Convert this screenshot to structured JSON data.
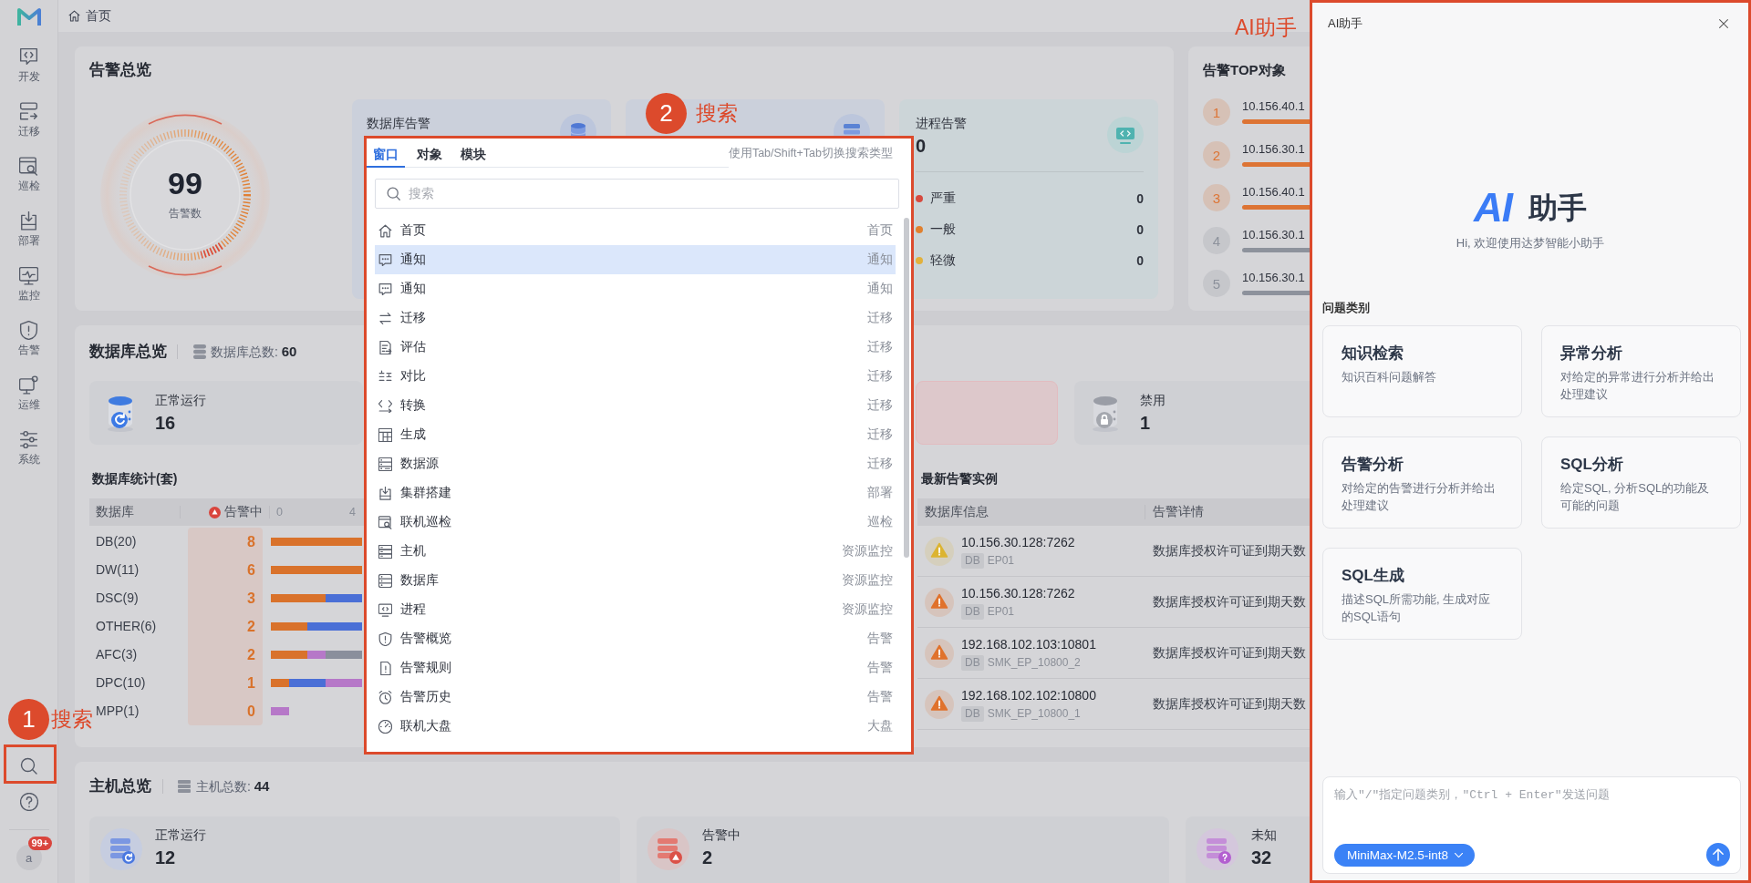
{
  "breadcrumb": {
    "label": "首页"
  },
  "sidebar": {
    "items": [
      {
        "label": "开发"
      },
      {
        "label": "迁移"
      },
      {
        "label": "巡检"
      },
      {
        "label": "部署"
      },
      {
        "label": "监控"
      },
      {
        "label": "告警"
      },
      {
        "label": "运维"
      },
      {
        "label": "系统"
      }
    ],
    "avatar": "a",
    "badge": "99+"
  },
  "alarm_overview": {
    "title": "告警总览",
    "total": "99",
    "total_label": "告警数",
    "cards": [
      {
        "kind": "database",
        "title": "数据库告警"
      },
      {
        "kind": "host"
      },
      {
        "kind": "process",
        "title": "进程告警",
        "value": "0",
        "levels": [
          {
            "label": "严重",
            "count": "0",
            "color": "#d64a3f"
          },
          {
            "label": "一般",
            "count": "0",
            "color": "#e0802f"
          },
          {
            "label": "轻微",
            "count": "0",
            "color": "#e2b13c"
          }
        ]
      }
    ]
  },
  "top_objects": {
    "title": "告警TOP对象",
    "items": [
      {
        "rank": "1",
        "name": "10.156.40.1",
        "color": "#dd7434"
      },
      {
        "rank": "2",
        "name": "10.156.30.1",
        "color": "#dd7434"
      },
      {
        "rank": "3",
        "name": "10.156.40.1",
        "color": "#dd7434"
      },
      {
        "rank": "4",
        "name": "10.156.30.1",
        "color": "#8d929c"
      },
      {
        "rank": "5",
        "name": "10.156.30.1",
        "color": "#8d929c"
      }
    ]
  },
  "database_overview": {
    "title": "数据库总览",
    "total": "数据库总数: **60**",
    "tiles": [
      {
        "kind": "normal",
        "label": "正常运行",
        "value": "16"
      },
      {
        "kind": "alarm"
      },
      {
        "kind": "disabled",
        "label": "禁用",
        "value": "1"
      }
    ],
    "stats": {
      "title": "数据库统计(套)",
      "columns": [
        "数据库",
        "告警中"
      ],
      "ticks": [
        "0",
        "4"
      ],
      "rows": [
        {
          "name": "DB(20)",
          "alarm": "8"
        },
        {
          "name": "DW(11)",
          "alarm": "6"
        },
        {
          "name": "DSC(9)",
          "alarm": "3"
        },
        {
          "name": "OTHER(6)",
          "alarm": "2"
        },
        {
          "name": "AFC(3)",
          "alarm": "2"
        },
        {
          "name": "DPC(10)",
          "alarm": "1"
        },
        {
          "name": "MPP(1)",
          "alarm": "0"
        }
      ]
    },
    "latest_alarms": {
      "title": "最新告警实例",
      "columns": [
        "数据库信息",
        "告警详情"
      ],
      "rows": [
        {
          "address": "10.156.30.128:7262",
          "type": "DB",
          "instance": "EP01",
          "detail": "数据库授权许可证到期天数",
          "color": "#dcb431"
        },
        {
          "address": "10.156.30.128:7262",
          "type": "DB",
          "instance": "EP01",
          "detail": "数据库授权许可证到期天数",
          "color": "#e0722c"
        },
        {
          "address": "192.168.102.103:10801",
          "type": "DB",
          "instance": "SMK_EP_10800_2",
          "detail": "数据库授权许可证到期天数",
          "color": "#e0722c"
        },
        {
          "address": "192.168.102.102:10800",
          "type": "DB",
          "instance": "SMK_EP_10800_1",
          "detail": "数据库授权许可证到期天数",
          "color": "#e0722c"
        }
      ]
    }
  },
  "host_overview": {
    "title": "主机总览",
    "total": "主机总数: **44**",
    "tiles": [
      {
        "kind": "normal",
        "label": "正常运行",
        "value": "12"
      },
      {
        "kind": "alarm",
        "label": "告警中",
        "value": "2"
      },
      {
        "kind": "unknown",
        "label": "未知",
        "value": "32"
      }
    ]
  },
  "search_popup": {
    "tabs": [
      {
        "label": "窗口",
        "selected": true
      },
      {
        "label": "对象",
        "selected": false
      },
      {
        "label": "模块",
        "selected": false
      }
    ],
    "hint": "使用Tab/Shift+Tab切换搜索类型",
    "placeholder": "搜索",
    "items": [
      {
        "label": "首页",
        "category": "首页",
        "selected": false
      },
      {
        "label": "通知",
        "category": "通知",
        "selected": true
      },
      {
        "label": "通知",
        "category": "通知",
        "selected": false
      },
      {
        "label": "迁移",
        "category": "迁移",
        "selected": false
      },
      {
        "label": "评估",
        "category": "迁移",
        "selected": false
      },
      {
        "label": "对比",
        "category": "迁移",
        "selected": false
      },
      {
        "label": "转换",
        "category": "迁移",
        "selected": false
      },
      {
        "label": "生成",
        "category": "迁移",
        "selected": false
      },
      {
        "label": "数据源",
        "category": "迁移",
        "selected": false
      },
      {
        "label": "集群搭建",
        "category": "部署",
        "selected": false
      },
      {
        "label": "联机巡检",
        "category": "巡检",
        "selected": false
      },
      {
        "label": "主机",
        "category": "资源监控",
        "selected": false
      },
      {
        "label": "数据库",
        "category": "资源监控",
        "selected": false
      },
      {
        "label": "进程",
        "category": "资源监控",
        "selected": false
      },
      {
        "label": "告警概览",
        "category": "告警",
        "selected": false
      },
      {
        "label": "告警规则",
        "category": "告警",
        "selected": false
      },
      {
        "label": "告警历史",
        "category": "告警",
        "selected": false
      },
      {
        "label": "联机大盘",
        "category": "大盘",
        "selected": false
      }
    ]
  },
  "ai_panel": {
    "title": "AI助手",
    "logo_mark": "AI",
    "logo_text": "助手",
    "greeting": "Hi, 欢迎使用达梦智能小助手",
    "section": "问题类别",
    "categories": [
      {
        "title": "知识检索",
        "description": "知识百科问题解答"
      },
      {
        "title": "异常分析",
        "description": "对给定的异常进行分析并给出处理建议"
      },
      {
        "title": "告警分析",
        "description": "对给定的告警进行分析并给出处理建议"
      },
      {
        "title": "SQL分析",
        "description": "给定SQL, 分析SQL的功能及可能的问题"
      },
      {
        "title": "SQL生成",
        "description": "描述SQL所需功能, 生成对应的SQL语句"
      }
    ],
    "input": {
      "placeholder": "输入\"/\"指定问题类别，\"Ctrl + Enter\"发送问题"
    },
    "model": "MiniMax-M2.5-int8"
  },
  "annotations": [
    {
      "number": "1",
      "label": "搜索"
    },
    {
      "number": "2",
      "label": "搜索"
    },
    {
      "label": "AI助手"
    }
  ]
}
